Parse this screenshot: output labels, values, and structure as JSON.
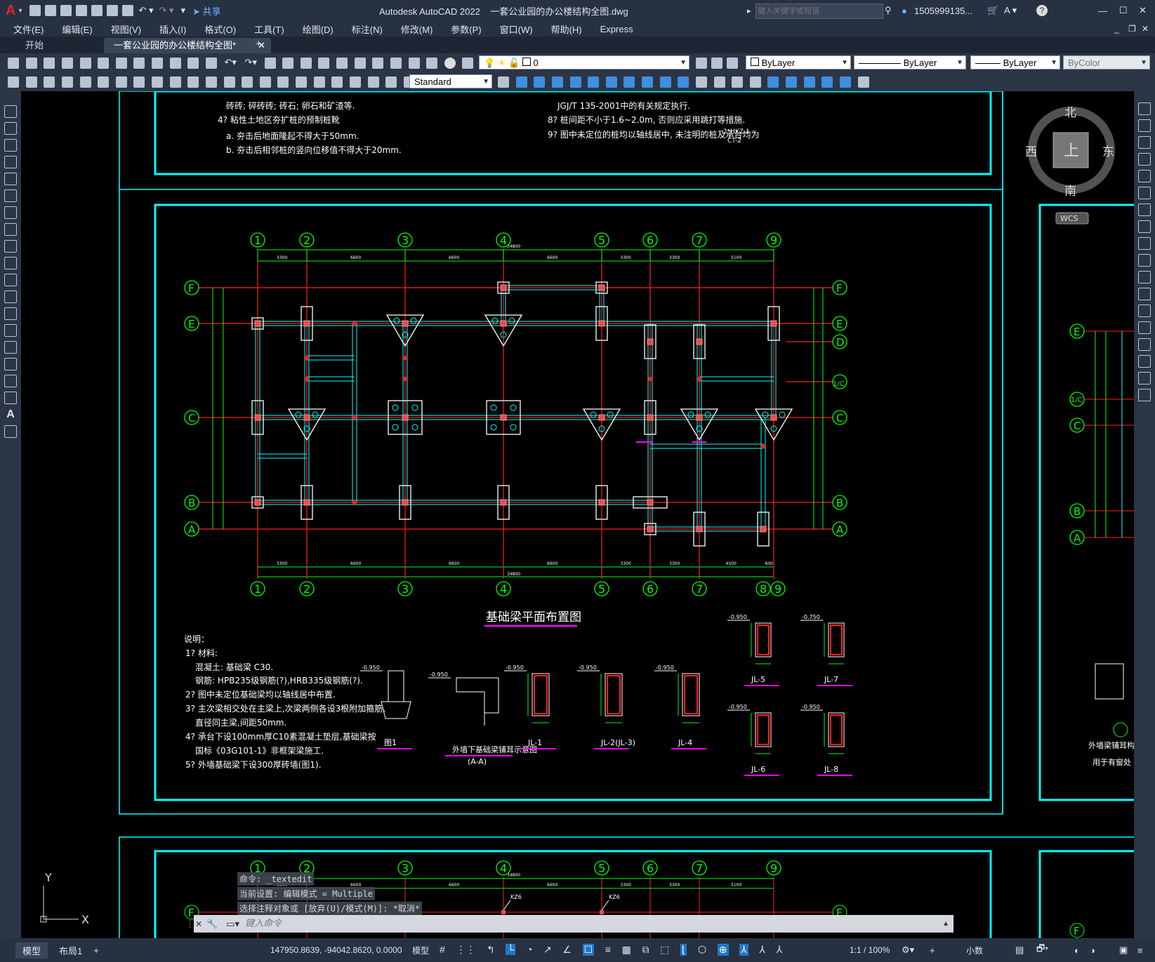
{
  "app": {
    "title": "Autodesk AutoCAD 2022",
    "filename": "一套公业园的办公楼结构全图.dwg",
    "share_label": "共享",
    "search_placeholder": "键入关键字或短语",
    "user": "1505999135...",
    "accent": "#1f78c8"
  },
  "menu": [
    "文件(E)",
    "编辑(E)",
    "视图(V)",
    "插入(I)",
    "格式(O)",
    "工具(T)",
    "绘图(D)",
    "标注(N)",
    "修改(M)",
    "参数(P)",
    "窗口(W)",
    "帮助(H)",
    "Express"
  ],
  "tabs": [
    {
      "label": "开始"
    },
    {
      "label": "一套公业园的办公楼结构全图*"
    }
  ],
  "toolbar": {
    "layer_value": "0",
    "color": "ByLayer",
    "linetype": "ByLayer",
    "lineweight": "ByLayer",
    "plotstyle": "ByColor",
    "textstyle": "Standard"
  },
  "viewcube": {
    "n": "北",
    "s": "南",
    "e": "东",
    "w": "西",
    "top": "上",
    "wcs": "WCS"
  },
  "ucs": {
    "x": "X",
    "y": "Y"
  },
  "drawing": {
    "title": "基础梁平面布置图",
    "notes_title": "说明：",
    "notes": [
      "1? 材料:",
      "混凝土:  基础梁  C30.",
      "钢筋:  HPB235级钢筋(?),HRB335级钢筋(?).",
      "2? 图中未定位基础梁均以轴线居中布置.",
      "3? 主次梁相交处在主梁上,次梁两侧各设3根附加箍筋,",
      "直径同主梁,间距50mm.",
      "4? 承台下设100mm厚C10素混凝土垫层,基础梁按",
      "国标《03G101-1》非框架梁施工.",
      "5? 外墙基础梁下设300厚砖墙(图1)."
    ],
    "top_notes_left": [
      "砖砖;  碎砖砖;  砖石;  卵石和矿渣等.",
      "4? 粘性土地区夯扩桩的预制桩靴",
      "a. 夯击后地面隆起不得大于50mm.",
      "b. 夯击后相邻桩的竖向位移值不得大于20mm."
    ],
    "top_notes_right": [
      "JGJ/T 135-2001中的有关规定执行.",
      "8? 桩间距不小于1.6~2.0m, 否则应采用跳打等措施.",
      "9? 图中未定位的桩均以轴线居中, 未注明的桩及承台均为"
    ],
    "top_frac_num": "2*HKZ-1",
    "top_frac_den": "CT-2",
    "axis_top": [
      "1",
      "2",
      "3",
      "4",
      "5",
      "6",
      "7",
      "9"
    ],
    "axis_bottom": [
      "1",
      "2",
      "3",
      "4",
      "5",
      "6",
      "7",
      "8",
      "9"
    ],
    "axis_left": [
      "F",
      "E",
      "C",
      "B",
      "A"
    ],
    "axis_right": [
      "F",
      "E",
      "D",
      "1/C",
      "C",
      "B",
      "A"
    ],
    "dims_top": [
      "3300",
      "6600",
      "6600",
      "6600",
      "3300",
      "3300",
      "5100"
    ],
    "dims_bottom": [
      "3300",
      "6600",
      "6600",
      "6600",
      "3300",
      "3300",
      "4500",
      "600"
    ],
    "dim_total": "34800",
    "sections": [
      {
        "label": "图1",
        "level": "-0.950"
      },
      {
        "label": "外墙下基础梁铺耳示意图",
        "sub": "(A-A)",
        "level": "-0.950"
      },
      {
        "label": "JL-1",
        "level": "-0.950"
      },
      {
        "label": "JL-2(JL-3)",
        "level": "-0.950"
      },
      {
        "label": "JL-4",
        "level": "-0.950"
      },
      {
        "label": "JL-5",
        "level": "-0.950"
      },
      {
        "label": "JL-7",
        "level": "-0.750"
      },
      {
        "label": "JL-6",
        "level": "-0.950"
      },
      {
        "label": "JL-8",
        "level": "-0.950"
      }
    ],
    "right_frame_labels": [
      "外墙梁铺耳构造",
      "用于有窗处"
    ],
    "lower_axis_top": [
      "1",
      "2",
      "3",
      "4",
      "5",
      "6",
      "7",
      "9"
    ],
    "lower_labels": [
      "KZ6",
      "KZ6"
    ],
    "lower_total": "34800",
    "right_axes": [
      "E",
      "1/C",
      "C",
      "B",
      "A",
      "F"
    ]
  },
  "command": {
    "lines": [
      "命令: _textedit",
      "当前设置: 编辑模式 = Multiple",
      "选择注释对象或 [放弃(U)/模式(M)]: *取消*"
    ],
    "placeholder": "键入命令"
  },
  "layout_tabs": [
    "模型",
    "布局1"
  ],
  "status": {
    "coords": "147950.8639, -94042.8620, 0.0000",
    "model": "模型",
    "scale": "1:1 / 100%",
    "units": "小数"
  }
}
